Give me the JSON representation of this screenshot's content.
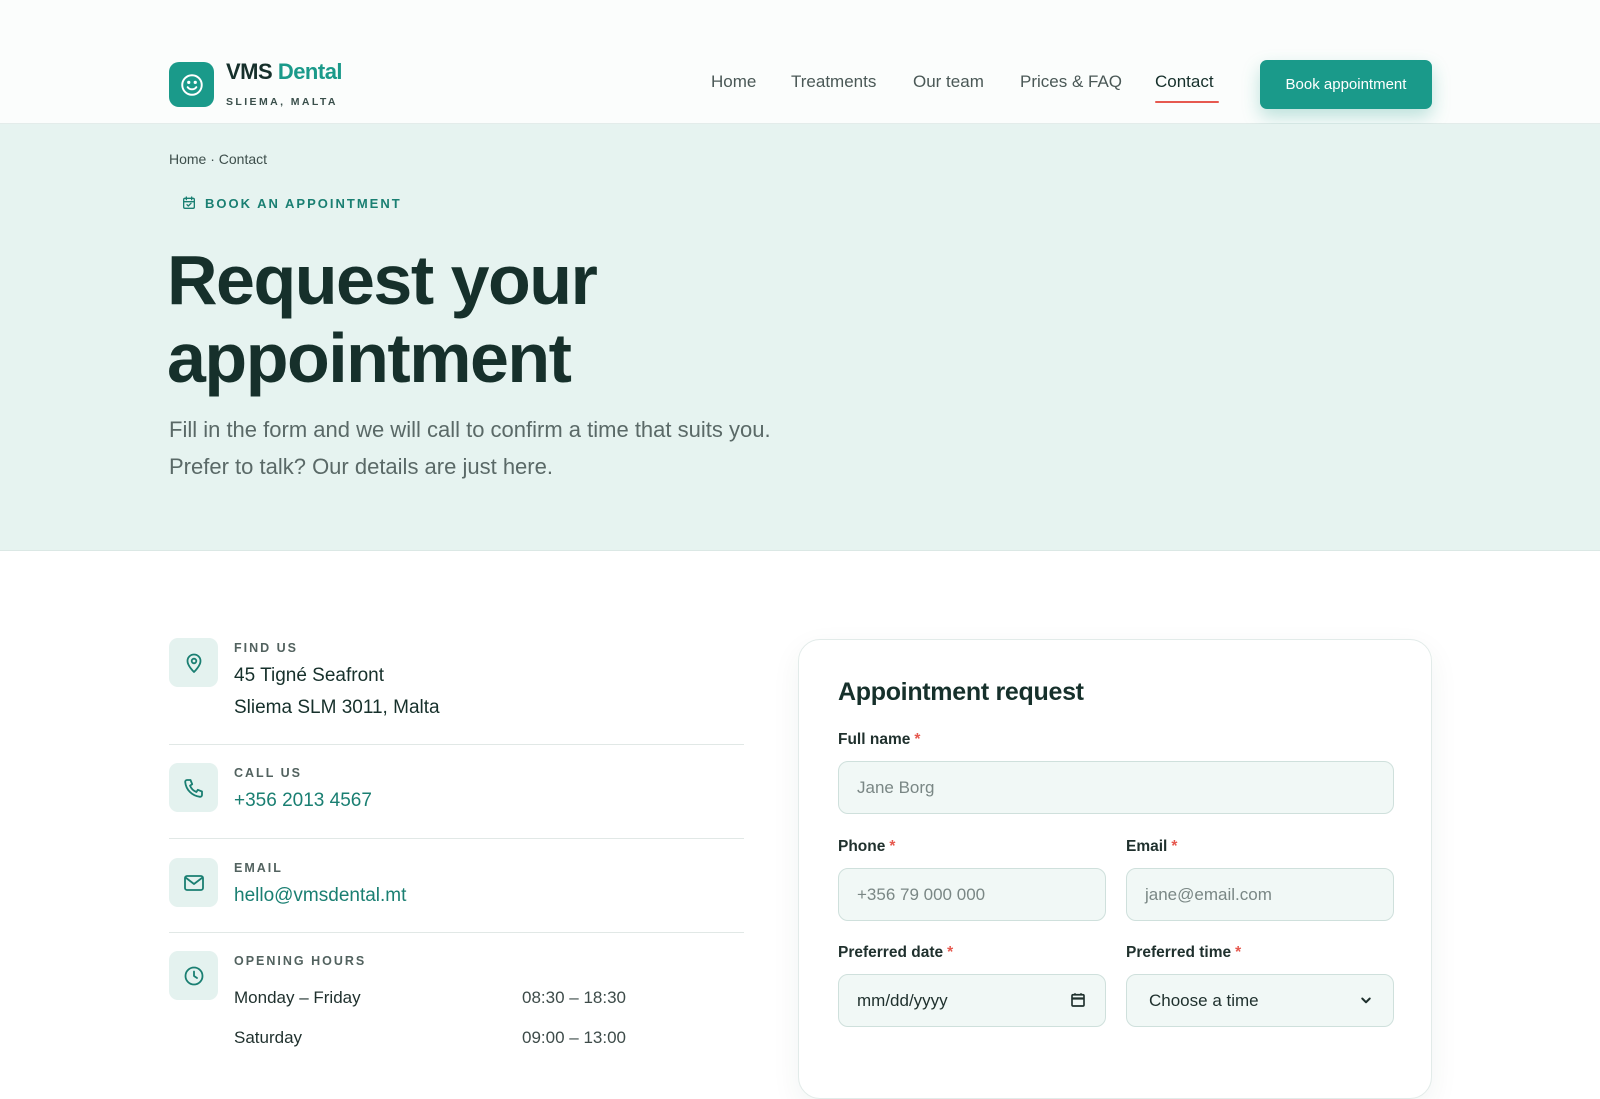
{
  "header": {
    "brand_part1": "VMS",
    "brand_part2": "Dental",
    "brand_sub": "SLIEMA, MALTA",
    "logo_icon": "smile-icon",
    "nav": [
      {
        "label": "Home"
      },
      {
        "label": "Treatments"
      },
      {
        "label": "Our team"
      },
      {
        "label": "Prices & FAQ"
      },
      {
        "label": "Contact",
        "active": true
      }
    ],
    "cta_label": "Book appointment"
  },
  "hero": {
    "breadcrumb": "Home · Contact",
    "eyebrow": "BOOK AN APPOINTMENT",
    "title_line1": "Request your",
    "title_line2": "appointment",
    "lead_line1": "Fill in the form and we will call to confirm a time that suits you.",
    "lead_line2": "Prefer to talk? Our details are just here."
  },
  "contact": {
    "find_us": {
      "label": "FIND US",
      "line1": "45 Tigné Seafront",
      "line2": "Sliema SLM 3011, Malta",
      "icon": "map-pin-icon"
    },
    "call_us": {
      "label": "CALL US",
      "value": "+356 2013 4567",
      "icon": "phone-icon"
    },
    "email": {
      "label": "EMAIL",
      "value": "hello@vmsdental.mt",
      "icon": "mail-icon"
    },
    "hours": {
      "label": "OPENING HOURS",
      "icon": "clock-icon",
      "rows": [
        {
          "day": "Monday – Friday",
          "time": "08:30 – 18:30"
        },
        {
          "day": "Saturday",
          "time": "09:00 – 13:00"
        }
      ]
    }
  },
  "form": {
    "title": "Appointment request",
    "full_name": {
      "label": "Full name",
      "placeholder": "Jane Borg"
    },
    "phone": {
      "label": "Phone",
      "placeholder": "+356 79 000 000"
    },
    "email": {
      "label": "Email",
      "placeholder": "jane@email.com"
    },
    "date": {
      "label": "Preferred date",
      "placeholder": "mm/dd/yyyy"
    },
    "time": {
      "label": "Preferred time",
      "selected": "Choose a time"
    },
    "required_marker": "*"
  },
  "colors": {
    "accent": "#1a9a8a",
    "accent_dark": "#1a7f72",
    "hero_bg": "#e6f3f0",
    "required": "#e6594f",
    "ink": "#16302b"
  }
}
